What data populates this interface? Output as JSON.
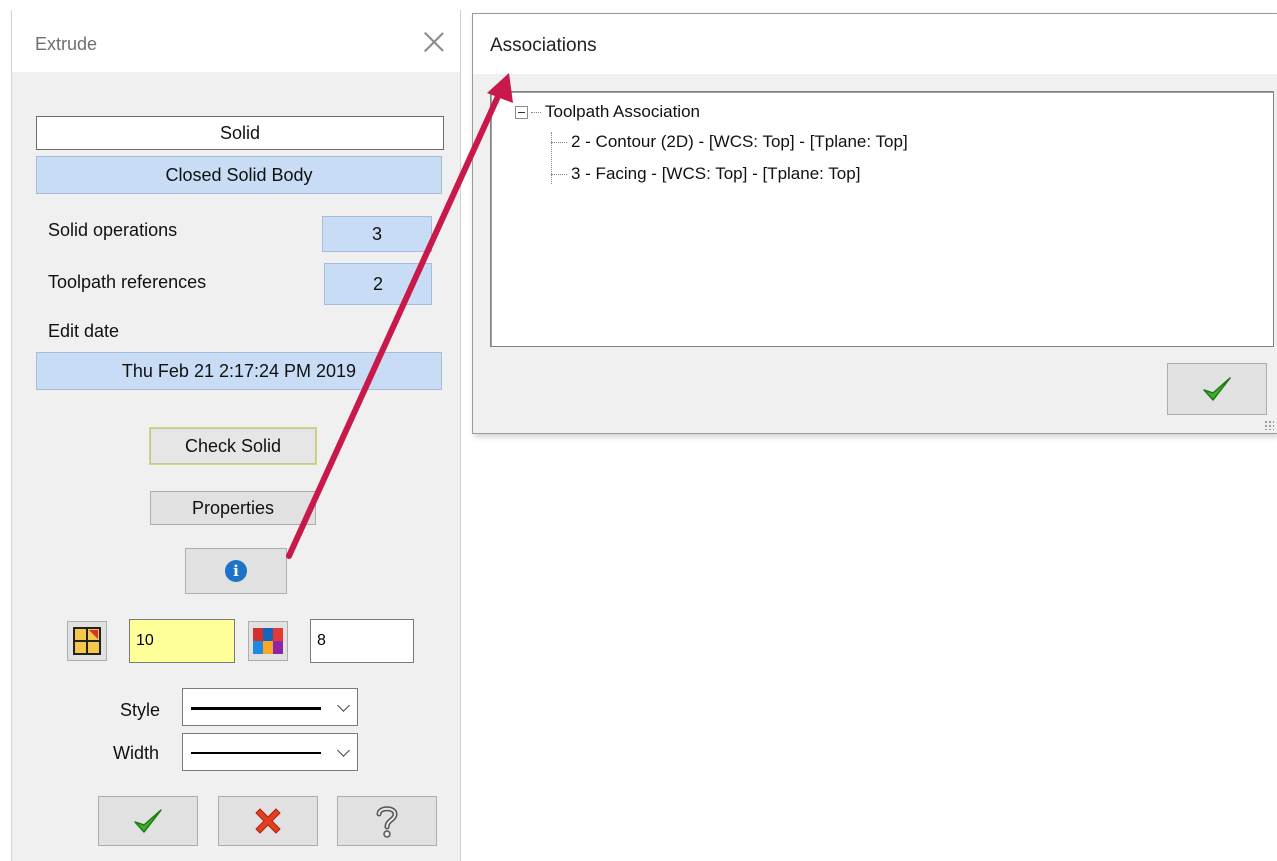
{
  "extrude": {
    "title": "Extrude",
    "solid_name": "Solid",
    "body_type": "Closed Solid Body",
    "solid_operations_label": "Solid operations",
    "solid_operations_value": "3",
    "toolpath_references_label": "Toolpath references",
    "toolpath_references_value": "2",
    "edit_date_label": "Edit date",
    "edit_date_value": "Thu Feb 21 2:17:24 PM 2019",
    "check_solid_label": "Check Solid",
    "properties_label": "Properties",
    "level_value": "10",
    "color_value": "8",
    "style_label": "Style",
    "width_label": "Width"
  },
  "associations": {
    "title": "Associations",
    "tree_root": "Toolpath Association",
    "tree_items": [
      "2 - Contour (2D) - [WCS: Top] - [Tplane: Top]",
      "3 - Facing - [WCS: Top] - [Tplane: Top]"
    ]
  },
  "colors": {
    "highlight_field": "#c8dcf5",
    "level_field": "#ffff99",
    "arrow": "#c8194a"
  }
}
